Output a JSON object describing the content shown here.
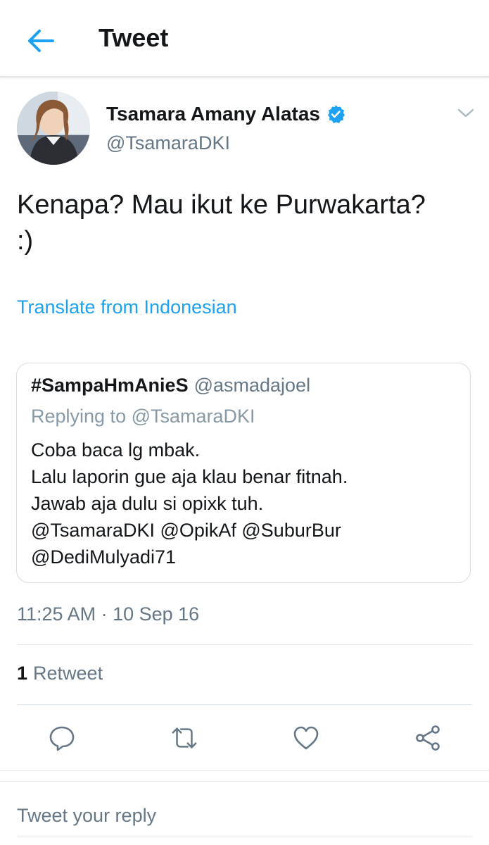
{
  "header": {
    "title": "Tweet",
    "back_icon": "arrow-left-icon"
  },
  "tweet": {
    "author_name": "Tsamara Amany Alatas",
    "author_handle": "@TsamaraDKI",
    "verified_icon": "verified-badge-icon",
    "more_icon": "chevron-down-icon",
    "text": "Kenapa? Mau ikut ke Purwakarta?\n:)",
    "translate_label": "Translate from Indonesian",
    "timestamp": "11:25 AM · 10 Sep 16",
    "retweet_count": "1",
    "retweet_label": "Retweet"
  },
  "quoted_tweet": {
    "author_name": "#SampaHmAnieS",
    "author_handle": "@asmadajoel",
    "replying_to": "Replying to @TsamaraDKI",
    "lines": [
      "Coba baca lg mbak.",
      "Lalu laporin gue aja klau benar fitnah.",
      "Jawab aja dulu si opixk tuh.",
      "@TsamaraDKI @OpikAf @SuburBur",
      "@DediMulyadi71"
    ]
  },
  "actions": [
    {
      "icon": "reply-icon"
    },
    {
      "icon": "retweet-icon"
    },
    {
      "icon": "like-heart-icon"
    },
    {
      "icon": "share-icon"
    }
  ],
  "reply": {
    "placeholder": "Tweet your reply"
  },
  "colors": {
    "accent": "#1da1f2",
    "text_primary": "#14171a",
    "text_secondary": "#657786",
    "divider": "#e1e8ed"
  }
}
